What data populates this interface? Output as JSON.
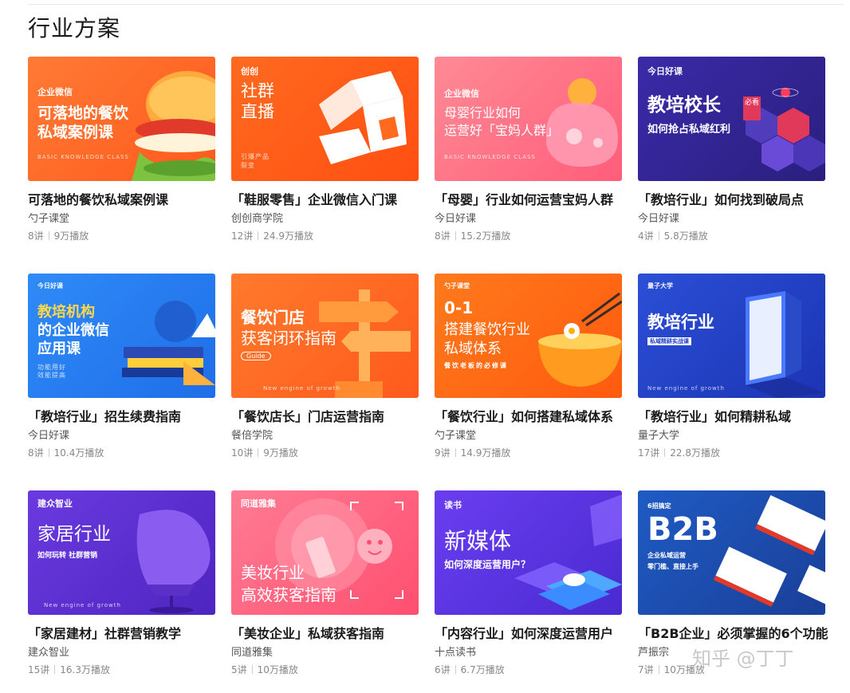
{
  "page": {
    "title": "行业方案"
  },
  "watermark": "知乎 @丁丁",
  "courses": [
    {
      "title": "可落地的餐饮私域案例课",
      "provider": "勺子课堂",
      "lessons": "8讲",
      "plays": "9万播放",
      "thumb": {
        "brand": "企业微信",
        "lines": [
          "可落地的餐饮",
          "私域案例课"
        ],
        "tiny": "BASIC KNOWLEDGE CLASS"
      }
    },
    {
      "title": "「鞋服零售」企业微信入门课",
      "provider": "创创商学院",
      "lessons": "12讲",
      "plays": "24.9万播放",
      "thumb": {
        "brand": "创创",
        "lines": [
          "社群",
          "直播"
        ],
        "small": [
          "引爆产品",
          "裂变"
        ]
      }
    },
    {
      "title": "「母婴」行业如何运营宝妈人群",
      "provider": "今日好课",
      "lessons": "8讲",
      "plays": "15.2万播放",
      "thumb": {
        "brand": "企业微信",
        "lines": [
          "母婴行业如何",
          "运营好「宝妈人群」"
        ],
        "tiny": "BASIC KNOWLEDGE CLASS"
      }
    },
    {
      "title": "「教培行业」如何找到破局点",
      "provider": "今日好课",
      "lessons": "4讲",
      "plays": "5.8万播放",
      "thumb": {
        "brand": "今日好课",
        "lines": [
          "教培校长"
        ],
        "badge": "必看",
        "sub": "如何抢占私域红利"
      }
    },
    {
      "title": "「教培行业」招生续费指南",
      "provider": "今日好课",
      "lessons": "8讲",
      "plays": "10.4万播放",
      "thumb": {
        "brand": "今日好课",
        "lines": [
          "教培机构",
          "的企业微信",
          "应用课"
        ],
        "small": [
          "功能用好",
          "效能提高"
        ]
      }
    },
    {
      "title": "「餐饮店长」门店运营指南",
      "provider": "餐倍学院",
      "lessons": "10讲",
      "plays": "9万播放",
      "thumb": {
        "lines": [
          "餐饮门店",
          "获客闭环指南"
        ],
        "pill": "Guide",
        "tiny": "New engine of growth"
      }
    },
    {
      "title": "「餐饮行业」如何搭建私域体系",
      "provider": "勺子课堂",
      "lessons": "9讲",
      "plays": "14.9万播放",
      "thumb": {
        "brand": "勺子课堂",
        "num": "0-1",
        "lines": [
          "搭建餐饮行业",
          "私域体系"
        ],
        "sub": "餐饮老板的必修课"
      }
    },
    {
      "title": "「教培行业」如何精耕私域",
      "provider": "量子大学",
      "lessons": "17讲",
      "plays": "22.8万播放",
      "thumb": {
        "brand": "量子大学",
        "lines": [
          "教培行业"
        ],
        "sub": "私域精耕实战课",
        "tiny": "New engine of growth"
      }
    },
    {
      "title": "「家居建材」社群营销教学",
      "provider": "建众智业",
      "lessons": "15讲",
      "plays": "16.3万播放",
      "thumb": {
        "brand": "建众智业",
        "lines": [
          "家居行业"
        ],
        "sub": "如何玩转 社群营销",
        "tiny": "New engine of growth"
      }
    },
    {
      "title": "「美妆企业」私域获客指南",
      "provider": "同道雅集",
      "lessons": "5讲",
      "plays": "10万播放",
      "thumb": {
        "brand": "同道雅集",
        "lines": [
          "美妆行业",
          "高效获客指南"
        ]
      }
    },
    {
      "title": "「内容行业」如何深度运营用户",
      "provider": "十点读书",
      "lessons": "6讲",
      "plays": "6.7万播放",
      "thumb": {
        "brand": "读书",
        "lines": [
          "新媒体"
        ],
        "sub": "如何深度运营用户？"
      }
    },
    {
      "title": "「B2B企业」必须掌握的6个功能",
      "provider": "芦振宗",
      "lessons": "7讲",
      "plays": "10万播放",
      "thumb": {
        "pre": "6招搞定",
        "lines": [
          "B2B"
        ],
        "sub": "企业私域运营",
        "sub2": "零门槛、直接上手"
      }
    }
  ],
  "colors": {
    "orange": "#ff6a1f",
    "pink": "#ff6b86",
    "purple": "#4a2bb0",
    "blue": "#2a7af0",
    "deepBlue": "#2141c8"
  }
}
